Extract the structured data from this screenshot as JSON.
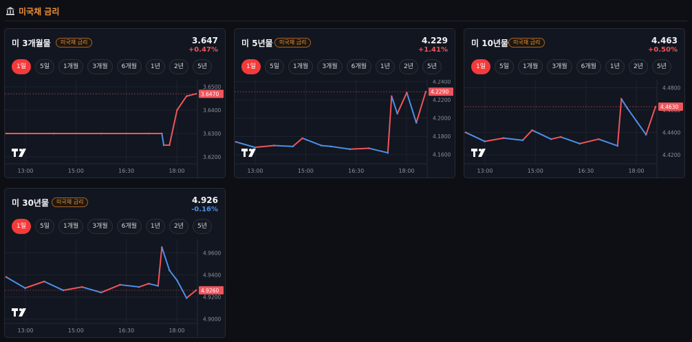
{
  "header": {
    "title": "미국채 금리",
    "icon": "bank-icon"
  },
  "tabs": [
    "1일",
    "5일",
    "1개월",
    "3개월",
    "6개월",
    "1년",
    "2년",
    "5년"
  ],
  "colors": {
    "up": "#f0555c",
    "down": "#4d90e8",
    "accent": "#f43a3a",
    "tag": "#f0923a"
  },
  "cards": [
    {
      "title": "미 3개월물",
      "tag": "미국채 금리",
      "price": "3.647",
      "change": "+0.47%",
      "direction": "up",
      "price_label": "3.6470"
    },
    {
      "title": "미 5년물",
      "tag": "미국채 금리",
      "price": "4.229",
      "change": "+1.41%",
      "direction": "up",
      "price_label": "4.2290"
    },
    {
      "title": "미 10년물",
      "tag": "미국채 금리",
      "price": "4.463",
      "change": "+0.50%",
      "direction": "up",
      "price_label": "4.4630"
    },
    {
      "title": "미 30년물",
      "tag": "미국채 금리",
      "price": "4.926",
      "change": "-0.16%",
      "direction": "down",
      "price_label": "4.9260"
    }
  ],
  "chart_data": [
    {
      "type": "line",
      "title": "미 3개월물",
      "x_ticks": [
        "13:00",
        "15:00",
        "16:30",
        "18:00"
      ],
      "y_ticks": [
        3.62,
        3.63,
        3.64,
        3.65
      ],
      "ylim": [
        3.617,
        3.653
      ],
      "last": 3.647,
      "series": [
        {
          "x": [
            0,
            0.25,
            0.5,
            0.75,
            0.82,
            0.83,
            0.86,
            0.9,
            0.95,
            1.0
          ],
          "values": [
            3.63,
            3.63,
            3.63,
            3.63,
            3.63,
            3.625,
            3.625,
            3.64,
            3.646,
            3.647
          ]
        }
      ]
    },
    {
      "type": "line",
      "title": "미 5년물",
      "x_ticks": [
        "13:00",
        "15:00",
        "16:30",
        "18:00"
      ],
      "y_ticks": [
        4.16,
        4.18,
        4.2,
        4.22,
        4.24
      ],
      "ylim": [
        4.15,
        4.242
      ],
      "last": 4.229,
      "series": [
        {
          "x": [
            0,
            0.1,
            0.2,
            0.3,
            0.35,
            0.45,
            0.5,
            0.6,
            0.7,
            0.8,
            0.82,
            0.85,
            0.9,
            0.95,
            1.0
          ],
          "values": [
            4.174,
            4.168,
            4.17,
            4.169,
            4.178,
            4.17,
            4.169,
            4.166,
            4.167,
            4.162,
            4.224,
            4.205,
            4.228,
            4.195,
            4.229
          ]
        }
      ]
    },
    {
      "type": "line",
      "title": "미 10년물",
      "x_ticks": [
        "13:00",
        "15:00",
        "16:30",
        "18:00"
      ],
      "y_ticks": [
        4.42,
        4.44,
        4.46,
        4.48
      ],
      "ylim": [
        4.412,
        4.487
      ],
      "last": 4.463,
      "series": [
        {
          "x": [
            0,
            0.1,
            0.2,
            0.3,
            0.35,
            0.45,
            0.5,
            0.6,
            0.7,
            0.8,
            0.82,
            0.85,
            0.9,
            0.95,
            1.0
          ],
          "values": [
            4.44,
            4.432,
            4.435,
            4.433,
            4.442,
            4.434,
            4.436,
            4.43,
            4.434,
            4.428,
            4.47,
            4.462,
            4.45,
            4.438,
            4.463
          ]
        }
      ]
    },
    {
      "type": "line",
      "title": "미 30년물",
      "x_ticks": [
        "13:00",
        "15:00",
        "16:30",
        "18:00"
      ],
      "y_ticks": [
        4.9,
        4.92,
        4.94,
        4.96
      ],
      "ylim": [
        4.896,
        4.972
      ],
      "last": 4.926,
      "series": [
        {
          "x": [
            0,
            0.1,
            0.2,
            0.3,
            0.4,
            0.5,
            0.6,
            0.7,
            0.75,
            0.8,
            0.82,
            0.86,
            0.9,
            0.95,
            1.0
          ],
          "values": [
            4.938,
            4.928,
            4.934,
            4.926,
            4.929,
            4.924,
            4.931,
            4.929,
            4.932,
            4.93,
            4.965,
            4.944,
            4.935,
            4.919,
            4.926
          ]
        }
      ]
    }
  ]
}
